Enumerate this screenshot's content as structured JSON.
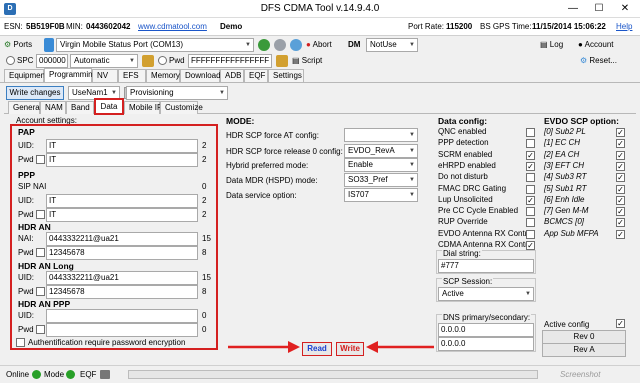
{
  "window": {
    "title": "DFS CDMA Tool v.14.9.4.0"
  },
  "info": {
    "esn_label": "ESN:",
    "esn": "5B519F0B",
    "min_label": "MIN:",
    "min": "0443602042",
    "site": "www.cdmatool.com",
    "mode": "Demo",
    "port_rate_label": "Port Rate:",
    "port_rate": "115200",
    "gps_label": "BS GPS Time:",
    "gps_time": "11/15/2014 15:06:22",
    "help": "Help"
  },
  "toolbar1": {
    "ports_label": "Ports",
    "port_value": "Virgin Mobile Status Port (COM13)",
    "abort_label": "Abort",
    "dm_label": "DM",
    "dm_value": "NotUse",
    "log_label": "Log",
    "account_label": "Account"
  },
  "toolbar2": {
    "spc_label": "SPC",
    "spc_value": "000000",
    "spc_mode": "Automatic",
    "pwd_label": "Pwd",
    "pwd_value": "FFFFFFFFFFFFFFFF",
    "script_label": "Script",
    "reset_label": "Reset..."
  },
  "main_tabs": [
    "Equipment",
    "Programming",
    "NV",
    "EFS",
    "Memory",
    "Download",
    "ADB",
    "EQF",
    "Settings"
  ],
  "prog": {
    "write_changes": "Write changes",
    "user_value": "UseNam1",
    "provisioning": "Provisioning"
  },
  "sub_tabs": [
    "General",
    "NAM",
    "Band",
    "Data",
    "Mobile IP",
    "Customize"
  ],
  "account": {
    "title": "Account settings:",
    "pap": {
      "title": "PAP",
      "uid_label": "UID:",
      "uid": "IT",
      "uid_n": "2",
      "pwd_label": "Pwd",
      "pwd": "IT",
      "pwd_n": "2"
    },
    "ppp": {
      "title": "PPP",
      "sip_label": "SIP NAI",
      "sip_n": "0",
      "uid_label": "UID:",
      "uid": "IT",
      "uid_n": "2",
      "pwd_label": "Pwd",
      "pwd": "IT",
      "pwd_n": "2"
    },
    "hdr_an": {
      "title": "HDR AN",
      "nai_label": "NAI:",
      "nai": "0443332211@ua21",
      "nai_n": "15",
      "pwd_label": "Pwd",
      "pwd": "12345678",
      "pwd_n": "8"
    },
    "hdr_an_long": {
      "title": "HDR AN Long",
      "uid_label": "UID:",
      "uid": "0443332211@ua21",
      "uid_n": "15",
      "pwd_label": "Pwd",
      "pwd": "12345678",
      "pwd_n": "8"
    },
    "hdr_an_ppp": {
      "title": "HDR AN PPP",
      "uid_label": "UID:",
      "uid": "",
      "uid_n": "0",
      "pwd_label": "Pwd",
      "pwd": "",
      "pwd_n": "0"
    },
    "auth_label": "Authentification require password encryption"
  },
  "mode": {
    "title": "MODE:",
    "rows": [
      {
        "label": "HDR SCP force AT config:",
        "value": ""
      },
      {
        "label": "HDR SCP force release 0 config:",
        "value": "EVDO_RevA"
      },
      {
        "label": "Hybrid preferred mode:",
        "value": "Enable"
      },
      {
        "label": "Data MDR (HSPD) mode:",
        "value": "SO33_Pref"
      },
      {
        "label": "Data service option:",
        "value": "IS707"
      }
    ]
  },
  "data_config": {
    "title": "Data config:",
    "items": [
      {
        "label": "QNC enabled",
        "checked": false
      },
      {
        "label": "PPP detection",
        "checked": false
      },
      {
        "label": "SCRM enabled",
        "checked": true
      },
      {
        "label": "eHRPD enabled",
        "checked": true
      },
      {
        "label": "Do not disturb",
        "checked": false
      },
      {
        "label": "FMAC DRC Gating",
        "checked": false
      },
      {
        "label": "Lup Unsolicited",
        "checked": true
      },
      {
        "label": "Pre CC Cycle Enabled",
        "checked": false
      },
      {
        "label": "RUP Override",
        "checked": false
      },
      {
        "label": "EVDO Antenna RX Control",
        "checked": false
      },
      {
        "label": "CDMA Antenna RX Control",
        "checked": true
      }
    ],
    "dial_label": "Dial string:",
    "dial_value": "#777",
    "scp_label": "SCP Session:",
    "scp_value": "Active",
    "dns_label": "DNS primary/secondary:",
    "dns1": "0.0.0.0",
    "dns2": "0.0.0.0"
  },
  "evdo": {
    "title": "EVDO SCP option:",
    "items": [
      {
        "label": "[0] Sub2 PL",
        "checked": true
      },
      {
        "label": "[1] EC CH",
        "checked": true
      },
      {
        "label": "[2] EA CH",
        "checked": true
      },
      {
        "label": "[3] EFT CH",
        "checked": true
      },
      {
        "label": "[4] Sub3 RT",
        "checked": true
      },
      {
        "label": "[5] Sub1 RT",
        "checked": true
      },
      {
        "label": "[6] Enh Idle",
        "checked": true
      },
      {
        "label": "[7] Gen M-M",
        "checked": true
      },
      {
        "label": "BCMCS [0]",
        "checked": true
      },
      {
        "label": "App Sub MFPA",
        "checked": true
      }
    ],
    "active_config_label": "Active config",
    "active_config_checked": true,
    "rev0": "Rev 0",
    "reva": "Rev A"
  },
  "actions": {
    "read": "Read",
    "write": "Write"
  },
  "status": {
    "online": "Online",
    "mode": "Mode",
    "eqf": "EQF",
    "watermark": "Screenshot"
  }
}
